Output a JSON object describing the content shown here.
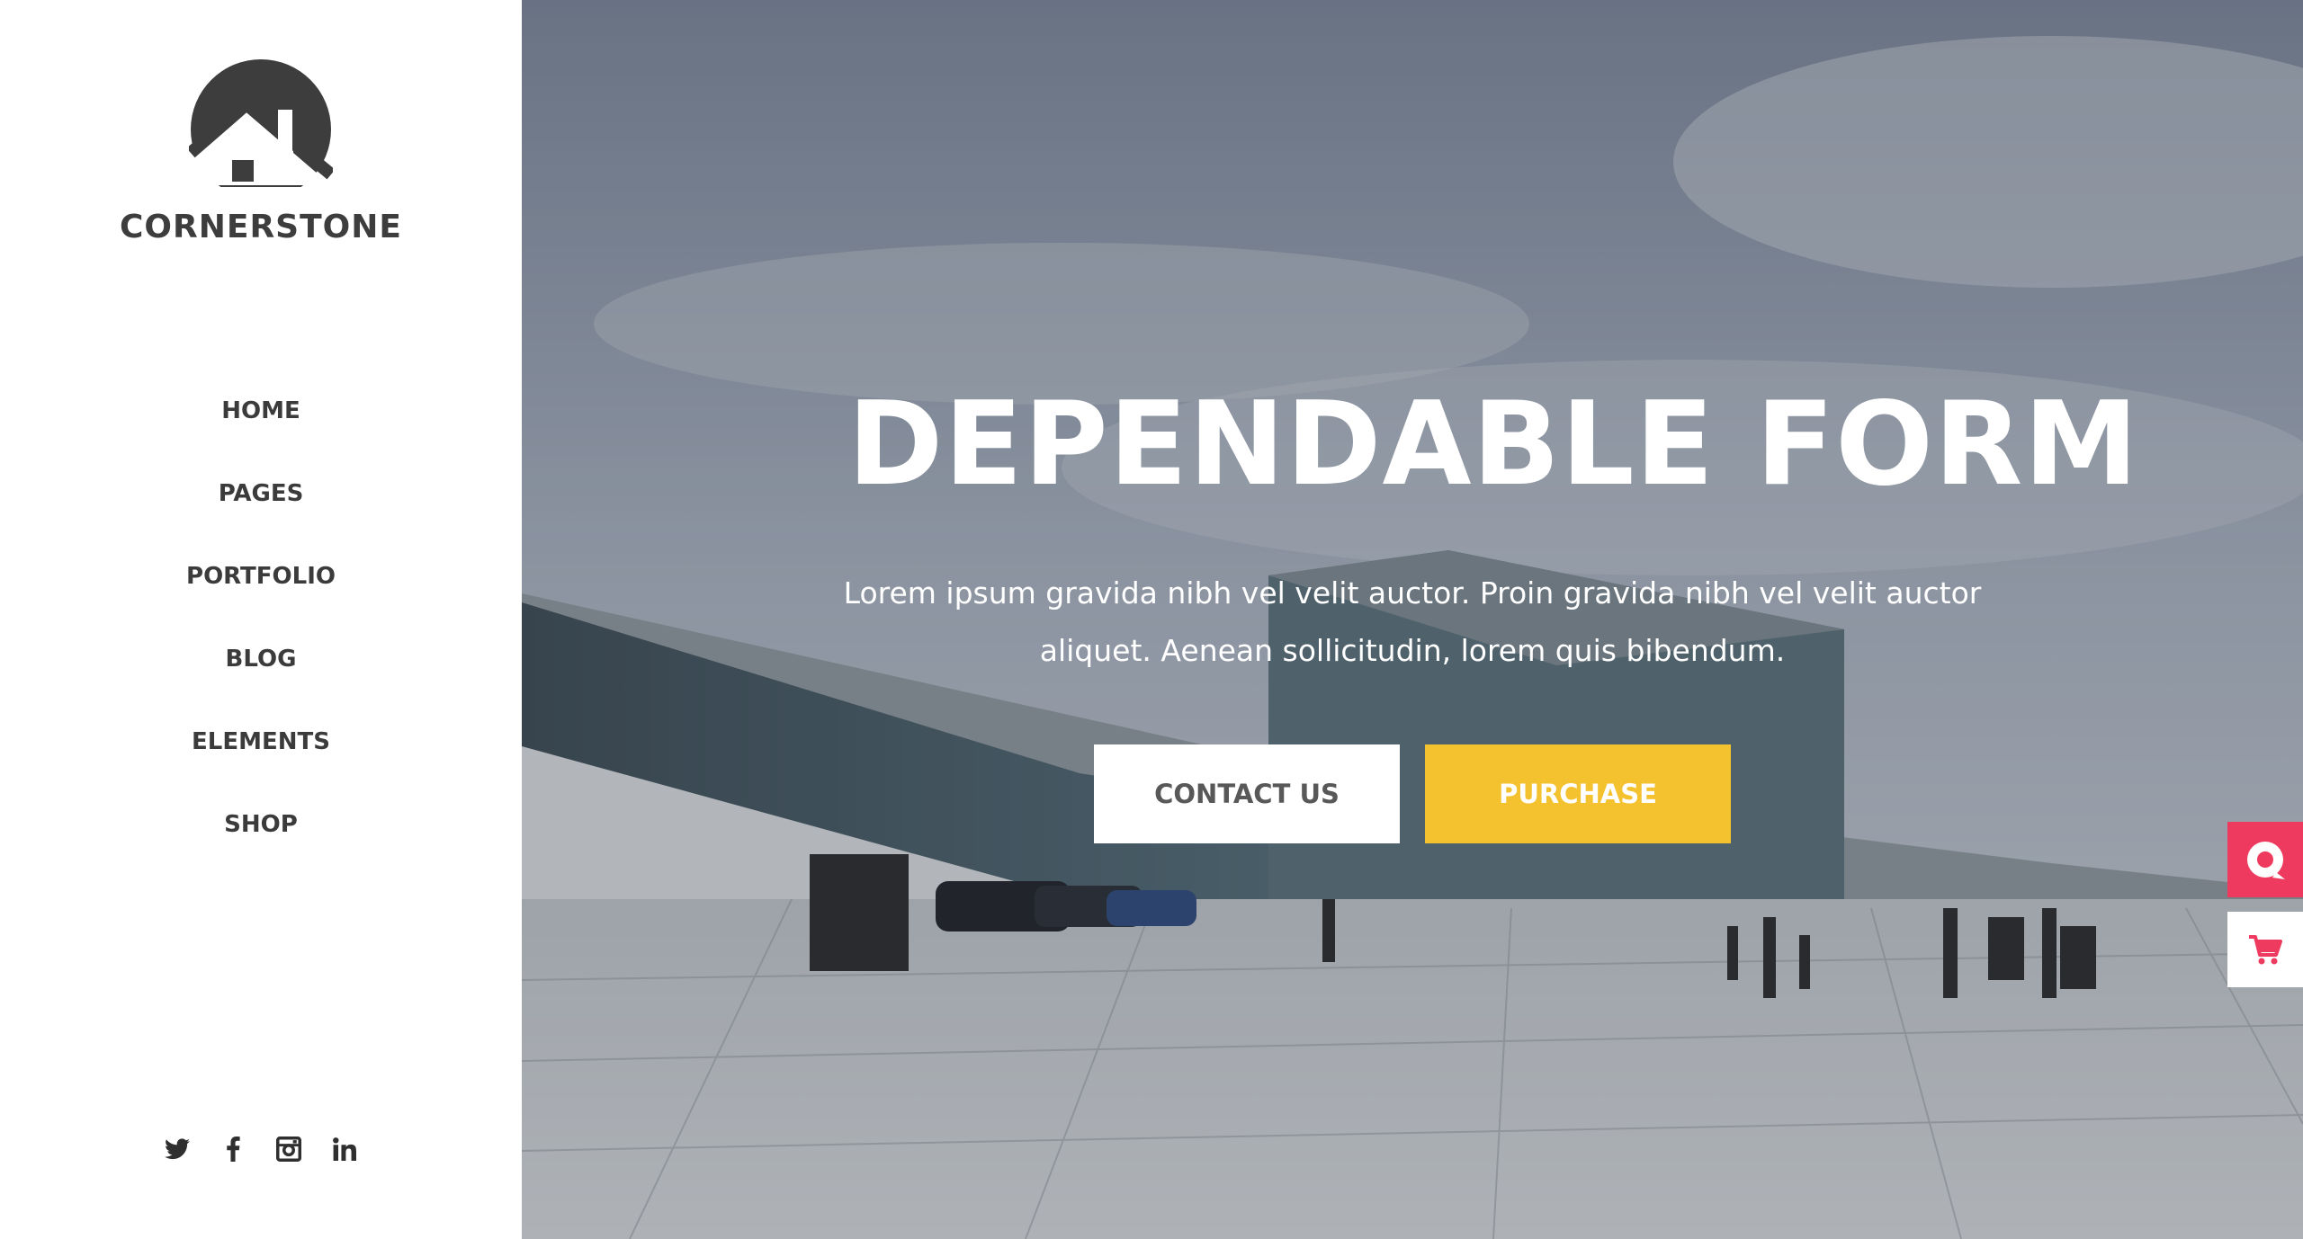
{
  "brand": {
    "name": "CORNERSTONE",
    "logo_icon": "house-circle-logo"
  },
  "nav": {
    "items": [
      {
        "label": "HOME"
      },
      {
        "label": "PAGES"
      },
      {
        "label": "PORTFOLIO"
      },
      {
        "label": "BLOG"
      },
      {
        "label": "ELEMENTS"
      },
      {
        "label": "SHOP"
      }
    ]
  },
  "social": [
    "twitter-icon",
    "facebook-icon",
    "instagram-icon",
    "linkedin-icon"
  ],
  "hero": {
    "title": "DEPENDABLE FORM",
    "text": "Lorem ipsum gravida nibh vel velit auctor. Proin gravida nibh vel velit auctor aliquet. Aenean sollicitudin, lorem quis bibendum.",
    "contact_label": "CONTACT US",
    "purchase_label": "PURCHASE"
  },
  "colors": {
    "accent_yellow": "#f4c12f",
    "accent_pink": "#ee3a5e",
    "text_dark": "#3b3b3b"
  }
}
